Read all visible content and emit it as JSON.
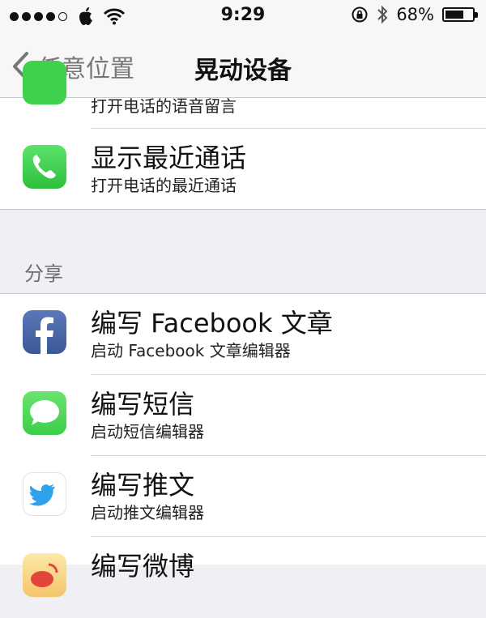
{
  "status": {
    "time": "9:29",
    "battery_text": "68%",
    "battery_level": 0.68
  },
  "nav": {
    "back_label": "任意位置",
    "title": "晃动设备"
  },
  "phone_rows": [
    {
      "title": "",
      "subtitle": "打开电话的语音留言",
      "icon": "phone-icon"
    },
    {
      "title": "显示最近通话",
      "subtitle": "打开电话的最近通话",
      "icon": "phone-icon"
    }
  ],
  "share": {
    "header": "分享",
    "rows": [
      {
        "title": "编写 Facebook 文章",
        "subtitle": "启动 Facebook 文章编辑器",
        "icon": "facebook-icon"
      },
      {
        "title": "编写短信",
        "subtitle": "启动短信编辑器",
        "icon": "messages-icon"
      },
      {
        "title": "编写推文",
        "subtitle": "启动推文编辑器",
        "icon": "twitter-icon"
      },
      {
        "title": "编写微博",
        "subtitle": "",
        "icon": "weibo-icon"
      }
    ]
  },
  "colors": {
    "phone_green": "#3fd04c",
    "facebook_blue": "#3b5998",
    "messages_green": "#4cd964",
    "twitter_blue": "#2ea3ec",
    "weibo_orange": "#f4a63a"
  }
}
